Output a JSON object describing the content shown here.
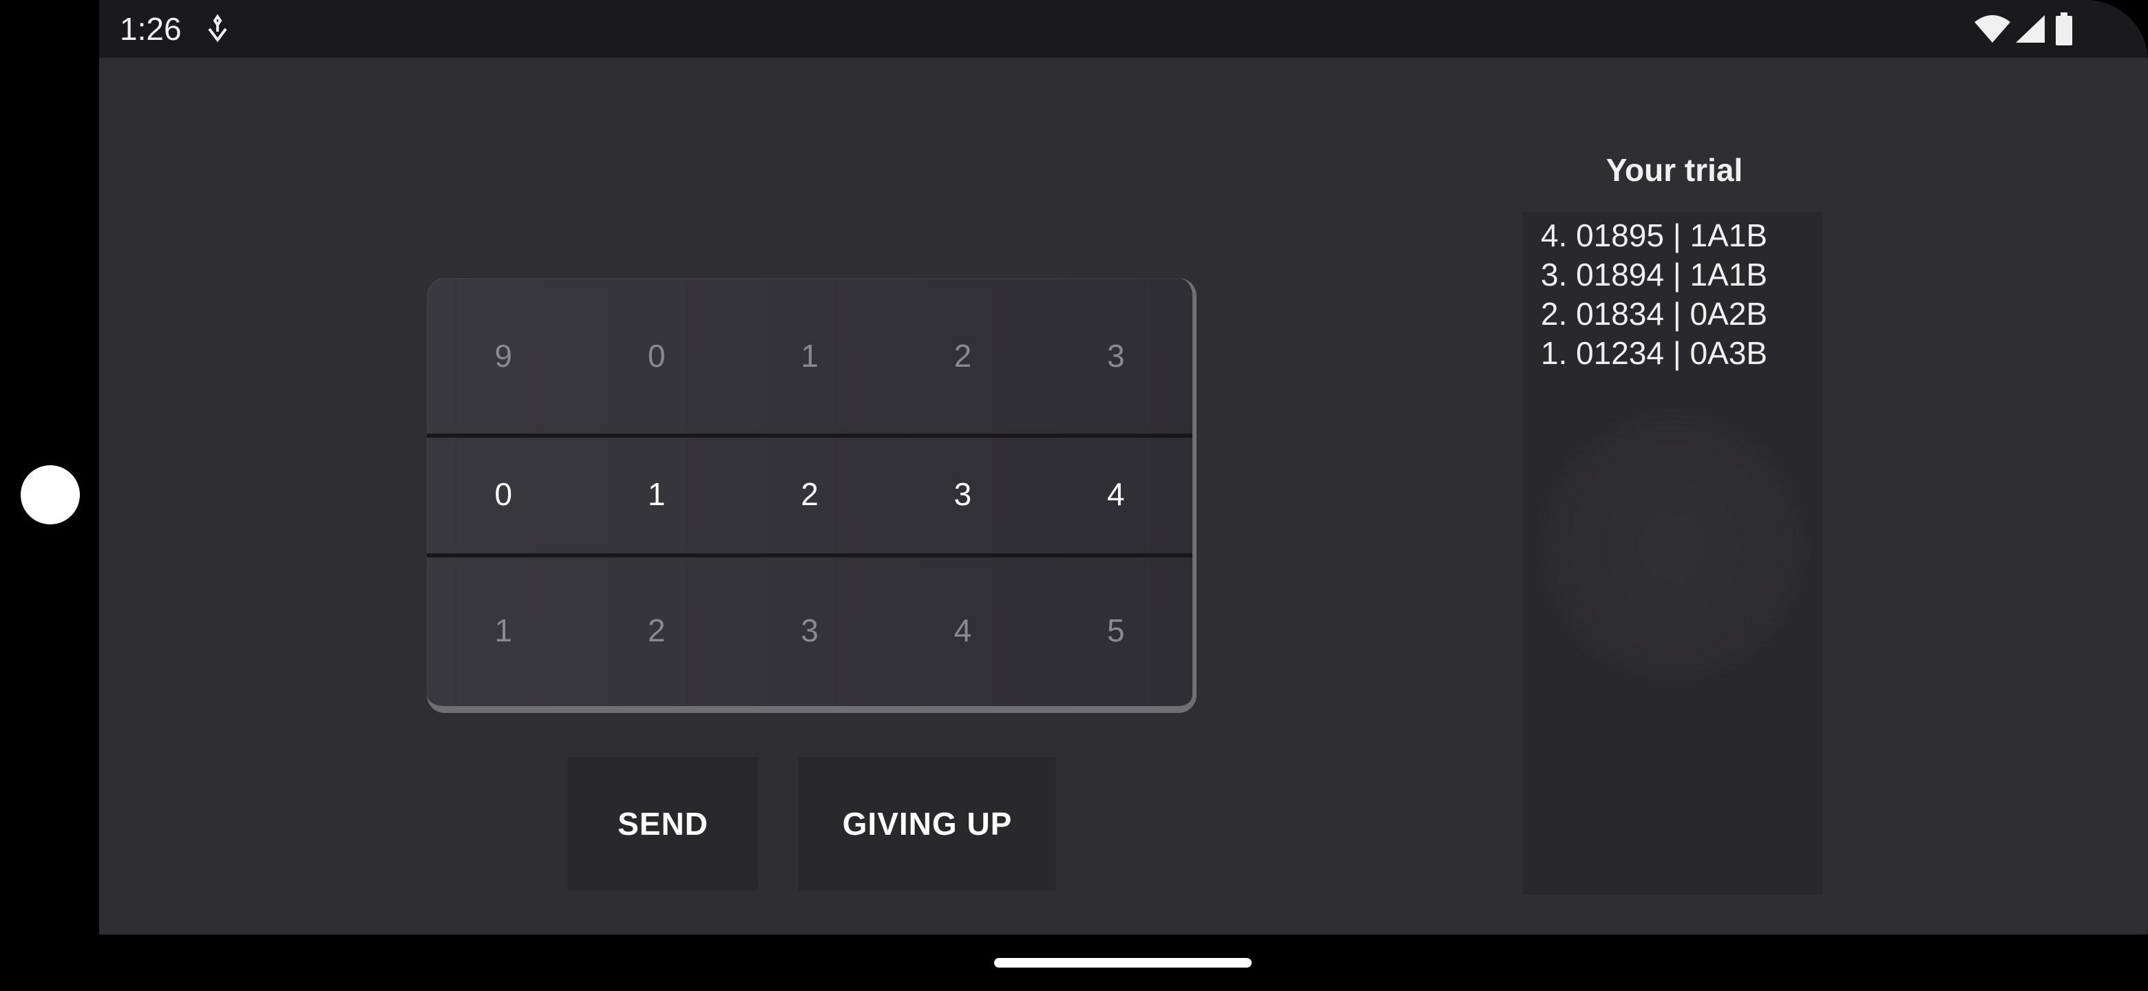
{
  "status_bar": {
    "time": "1:26",
    "icons": [
      "notification-icon",
      "wifi-icon",
      "signal-icon",
      "battery-icon"
    ]
  },
  "picker": {
    "rows": [
      [
        "9",
        "0",
        "1",
        "2",
        "3"
      ],
      [
        "0",
        "1",
        "2",
        "3",
        "4"
      ],
      [
        "1",
        "2",
        "3",
        "4",
        "5"
      ]
    ]
  },
  "buttons": {
    "send_label": "SEND",
    "giveup_label": "GIVING UP"
  },
  "trial": {
    "title": "Your trial",
    "entries": [
      "4.  01895 | 1A1B",
      "3.  01894 | 1A1B",
      "2.  01834 | 0A2B",
      "1.  01234 | 0A3B"
    ]
  },
  "colors": {
    "background": "#2f2e31",
    "status_bar": "#1a191c",
    "button": "#29282b",
    "text": "#ffffff",
    "dim_text": "#8a898d"
  }
}
